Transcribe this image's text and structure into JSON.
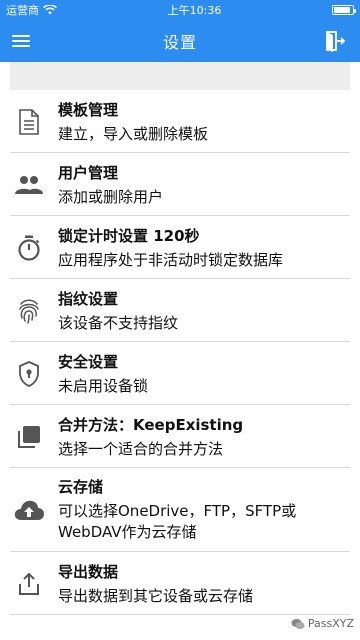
{
  "status_bar": {
    "carrier": "运营商",
    "time": "上午10:36"
  },
  "nav": {
    "title": "设置",
    "left_icon": "menu-icon",
    "right_icon": "exit-icon"
  },
  "colors": {
    "primary": "#2d8cf0",
    "icon": "#555555",
    "divider": "#d9d9d9",
    "band": "#ededed"
  },
  "items": [
    {
      "icon": "document-icon",
      "title": "模板管理",
      "subtitle": "建立，导入或删除模板"
    },
    {
      "icon": "users-icon",
      "title": "用户管理",
      "subtitle": "添加或删除用户"
    },
    {
      "icon": "timer-icon",
      "title": "锁定计时设置 120秒",
      "subtitle": "应用程序处于非活动时锁定数据库"
    },
    {
      "icon": "fingerprint-icon",
      "title": "指纹设置",
      "subtitle": "该设备不支持指纹"
    },
    {
      "icon": "shield-icon",
      "title": "安全设置",
      "subtitle": "未启用设备锁"
    },
    {
      "icon": "copy-icon",
      "title": "合并方法：KeepExisting",
      "subtitle": "选择一个适合的合并方法"
    },
    {
      "icon": "cloud-upload-icon",
      "title": "云存储",
      "subtitle": "可以选择OneDrive，FTP，SFTP或WebDAV作为云存储"
    },
    {
      "icon": "share-icon",
      "title": "导出数据",
      "subtitle": "导出数据到其它设备或云存储"
    }
  ],
  "watermark": "PassXYZ"
}
